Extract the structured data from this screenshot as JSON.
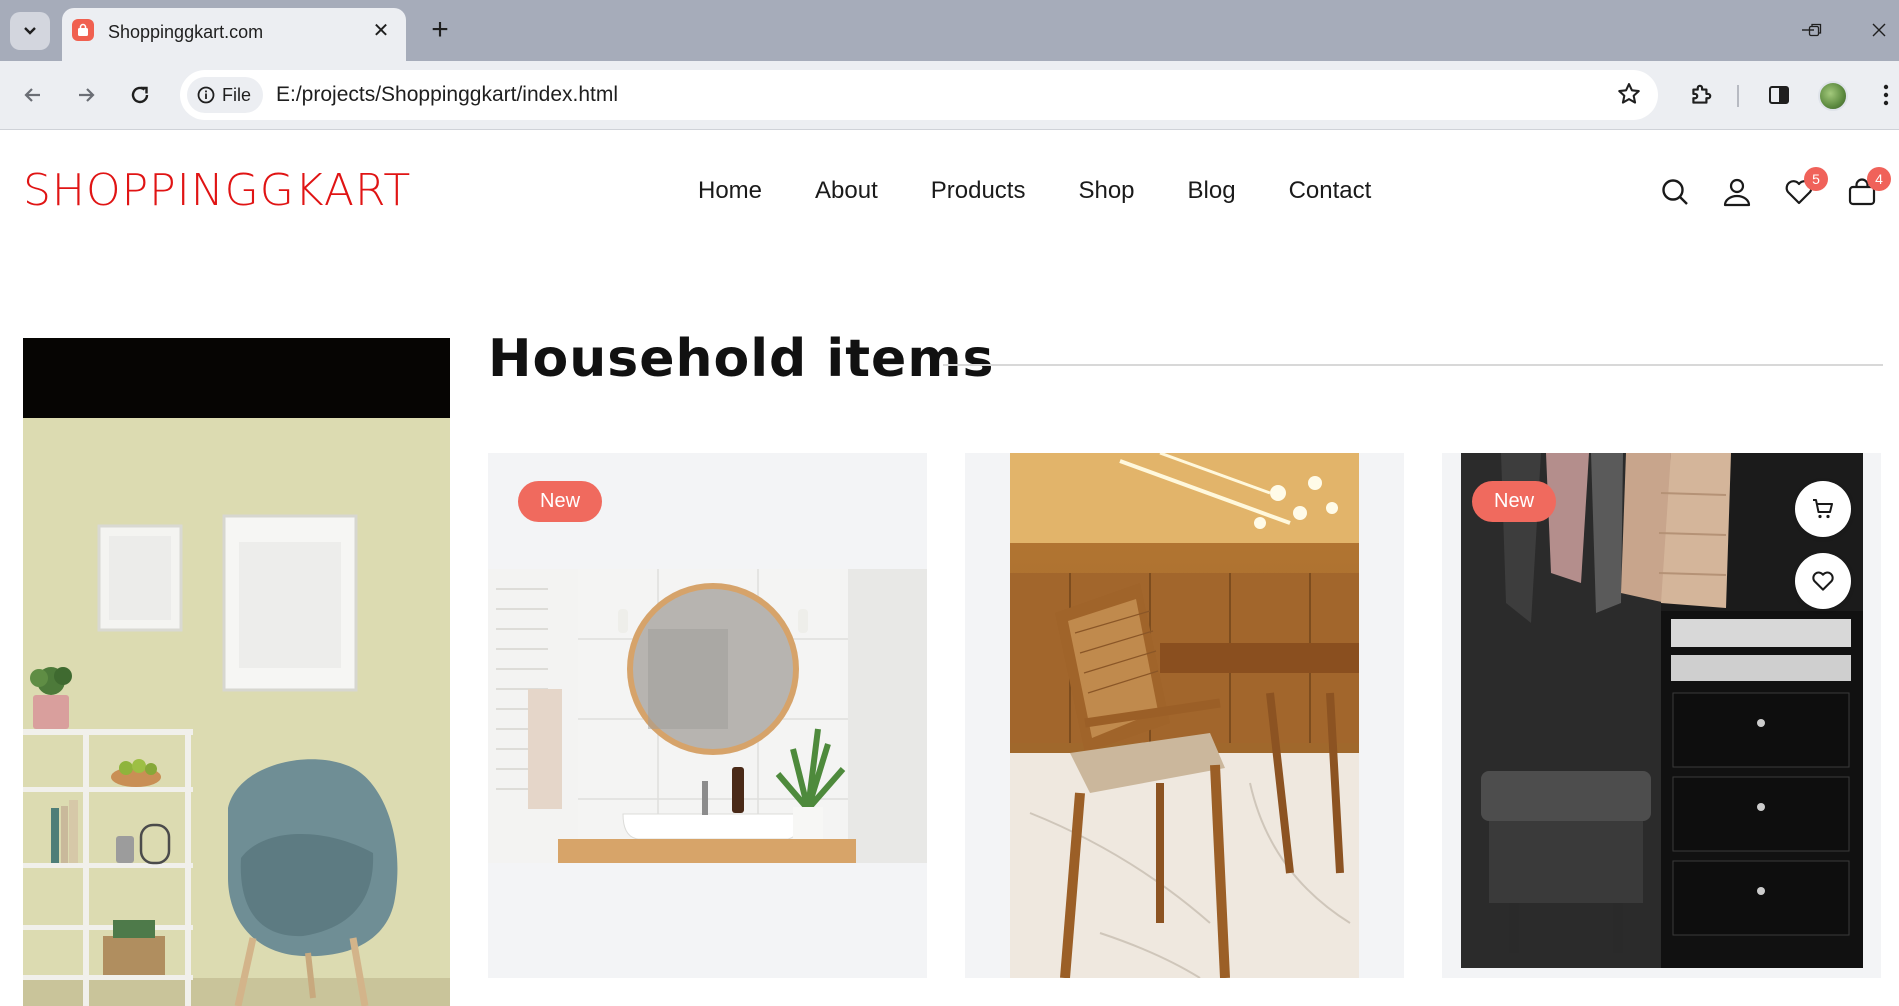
{
  "browser": {
    "tab_title": "Shoppinggkart.com",
    "chip_label": "File",
    "url": "E:/projects/Shoppinggkart/index.html",
    "colors": {
      "tabbar": "#a6acba",
      "toolbar": "#eceef2",
      "favicon": "#f06050"
    }
  },
  "site": {
    "logo": "SHOPPINGGKART",
    "nav": [
      "Home",
      "About",
      "Products",
      "Shop",
      "Blog",
      "Contact"
    ],
    "wishlist_count": "5",
    "cart_count": "4",
    "colors": {
      "brand": "#e01414",
      "badge": "#f0625a",
      "accent": "#f06a5e"
    }
  },
  "section": {
    "title": "Household items"
  },
  "products": [
    {
      "badge": "New",
      "image": "bathroom-mirror-sink"
    },
    {
      "badge": "",
      "image": "wooden-chair-dining-room"
    },
    {
      "badge": "New",
      "image": "wardrobe-drawers-ottoman",
      "actions": [
        "cart-icon",
        "heart-icon"
      ]
    }
  ]
}
